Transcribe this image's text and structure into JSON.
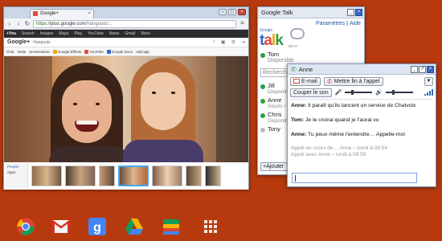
{
  "browser": {
    "tab_title": "Google+",
    "url_scheme": "https://",
    "url_host": "plus.google.com",
    "url_path": "/hangouts/...",
    "gbar_items": [
      "+You",
      "Search",
      "Images",
      "Maps",
      "Play",
      "YouTube",
      "News",
      "Gmail",
      "More"
    ],
    "gplus_logo": "Google+",
    "gplus_title": "Hangouts",
    "toolbar_items": [
      "Chat",
      "Invite",
      "Screenshare",
      "Google Effects",
      "YouTube",
      "Google Docs",
      "Add app"
    ],
    "strip_side_items": [
      "People",
      "Apps"
    ]
  },
  "talk": {
    "title": "Google Talk",
    "links": {
      "settings": "Paramètres",
      "sep": "|",
      "help": "Aide"
    },
    "logo_small": "Google",
    "logo_beta": "BETA",
    "me": {
      "name": "Tom",
      "status": "Disponible"
    },
    "search_placeholder": "Rechercher...",
    "contacts": [
      {
        "name": "Jill",
        "status": "Disponible",
        "online": true
      },
      {
        "name": "Anne",
        "status": "Souris !",
        "online": true
      },
      {
        "name": "Chris",
        "status": "Disponible",
        "online": true
      },
      {
        "name": "Tony",
        "status": "",
        "online": false
      }
    ],
    "add_button": "+Ajouter"
  },
  "chat": {
    "title": "Anne",
    "email_button": "E-mail",
    "end_call_button": "Mettre fin à l'appel",
    "mute_button": "Couper le son",
    "messages": [
      {
        "sender": "Anne:",
        "text": "Il paraît qu'ils lancent un service de Chatvoix"
      },
      {
        "sender": "Tom:",
        "text": "Je le croirai quand je l'aurai vu"
      },
      {
        "sender": "Anne:",
        "text": "Tu peux même l'entendre… Appelle-moi"
      }
    ],
    "system_lines": [
      "Appel en cours de… Anne – lundi à 08:54",
      "Appel avec Anne – lundi à 08:59"
    ],
    "input_value": ""
  },
  "shelf": {
    "apps": [
      "chrome-icon",
      "gmail-icon",
      "google-search-icon",
      "drive-icon",
      "web-store-icon",
      "app-launcher-icon"
    ]
  }
}
